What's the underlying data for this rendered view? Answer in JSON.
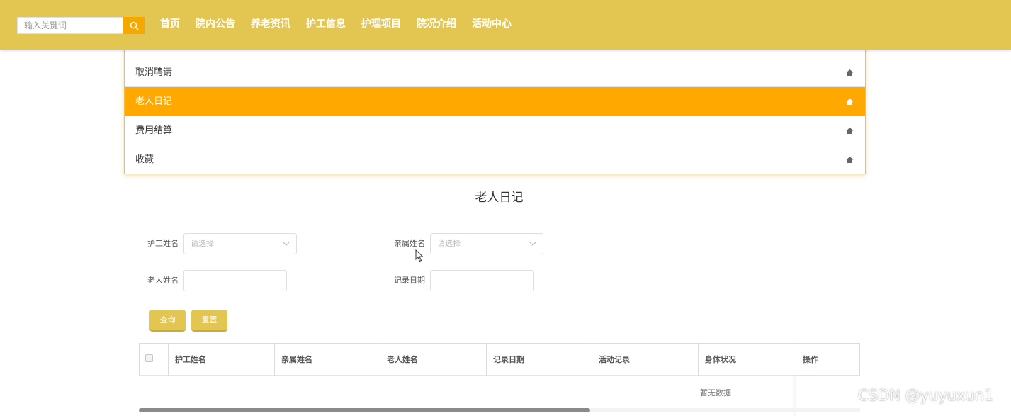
{
  "header": {
    "search_placeholder": "输入关键词",
    "nav": [
      "首页",
      "院内公告",
      "养老资讯",
      "护工信息",
      "护理项目",
      "院况介绍",
      "活动中心"
    ]
  },
  "menu": {
    "items": [
      {
        "label": "取消聘请",
        "active": false
      },
      {
        "label": "老人日记",
        "active": true
      },
      {
        "label": "费用结算",
        "active": false
      },
      {
        "label": "收藏",
        "active": false
      }
    ],
    "icon": "home-icon"
  },
  "page": {
    "title": "老人日记"
  },
  "form": {
    "caregiver_label": "护工姓名",
    "caregiver_placeholder": "请选择",
    "relative_label": "亲属姓名",
    "relative_placeholder": "请选择",
    "elder_label": "老人姓名",
    "elder_value": "",
    "date_label": "记录日期",
    "date_value": "",
    "search_button": "查询",
    "reset_button": "重置"
  },
  "table": {
    "headers": [
      "护工姓名",
      "亲属姓名",
      "老人姓名",
      "记录日期",
      "活动记录",
      "身体状况",
      "操作"
    ],
    "rows": [],
    "empty_text": "暂无数据"
  },
  "watermark": "CSDN @yuyuxun1",
  "colors": {
    "accent": "#e3c552",
    "active": "#ffa800"
  }
}
